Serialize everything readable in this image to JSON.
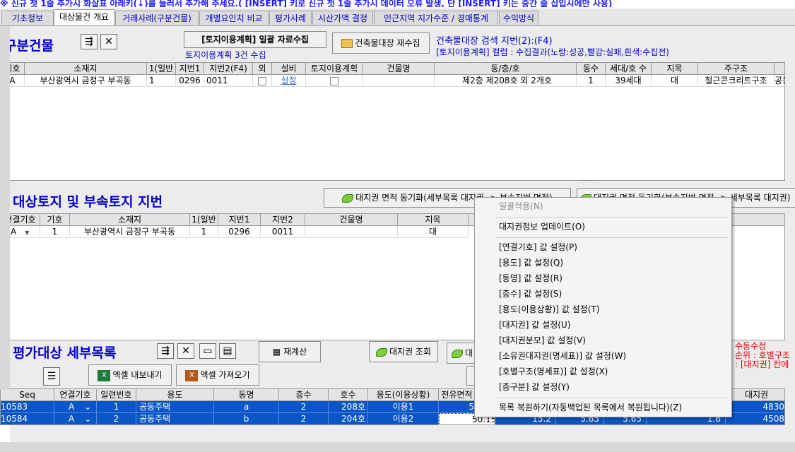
{
  "notice": "※ 신규 첫 1줄 추가시 화살표 아래키(↓)를 눌러서 추가해 주세요.( [INSERT] 키로 신규 첫 1줄 추가시 데이터 오류 발생, 단 [INSERT] 키는 중간 줄 삽입시에만 사용)",
  "tabs": [
    "기초정보",
    "대상물건 개요",
    "거래사례(구분건물)",
    "개별요인치 비교",
    "평가사례",
    "시산가액 결정",
    "인근지역 지가수준 / 경매통계",
    "수익방식"
  ],
  "section1": {
    "title": "구분건물",
    "bulk_button": "[토지이용계획] 일괄 자료수집",
    "recollect_button": "건축물대장 재수집",
    "search_info": "건축물대장 검색 지번(2):(F4)",
    "count_info": "토지이용계획 3건 수집",
    "legend_info": "[토지이용계획] 컬럼 : 수집결과(노랑:성공,빨강:실패,흰색:수집전)",
    "columns": [
      "기호",
      "소재지",
      "1(일반",
      "지번1",
      "지번2(F4)",
      "외",
      "설비",
      "토지이용계획",
      "건물명",
      "동/층/호",
      "동수",
      "세대/호 수",
      "지목",
      "주구조",
      ""
    ],
    "row": [
      "A",
      "부산광역시 금정구 부곡동",
      "1",
      "0296",
      "0011",
      "",
      "설정",
      "",
      "",
      "제2층 제208호 외 2개호",
      "1",
      "39세대",
      "대",
      "철근콘크리트구조",
      "공동주"
    ]
  },
  "section2": {
    "title": "대상토지 및 부속토지 지번",
    "sync_button_1": "대지권 면적 동기화(세부목록 대지권 -> 부속지번 면적)",
    "sync_button_2": "대지권 면적 동기화(부속지번 면적 -> 세부목록 대지권)",
    "columns": [
      "연결기호",
      "기호",
      "소재지",
      "1(일반",
      "지번1",
      "지번2",
      "건물명",
      "지목"
    ],
    "row": [
      "A",
      "1",
      "부산광역시 금정구 부곡동",
      "1",
      "0296",
      "0011",
      "",
      "대"
    ]
  },
  "section3": {
    "title": "평가대상 세부목록",
    "recalc_button": "재계산",
    "lookup_button": "대지권 조회",
    "lookup_button_2": "대",
    "export_button": "엑셀 내보내기",
    "import_button": "엑셀 가져오기",
    "red_notes": [
      "수동수정",
      "순위 : 호별구조",
      ": [대지권] 칸에"
    ],
    "columns": [
      "Seq",
      "연결기호",
      "일련번호",
      "용도",
      "동명",
      "층수",
      "호수",
      "용도(이용상황)",
      "전유면적",
      "",
      "",
      "",
      "",
      "대지권",
      ""
    ],
    "rows": [
      [
        "10583",
        "A",
        "1",
        "공동주택",
        "a",
        "2",
        "208호",
        "이용1",
        "5",
        "",
        "",
        "",
        "",
        "4830",
        ""
      ],
      [
        "10584",
        "A",
        "2",
        "공동주택",
        "b",
        "2",
        "204호",
        "이용2",
        "50.15",
        "15.2",
        "5.65",
        "5.65",
        "1.6",
        "4508",
        ""
      ]
    ]
  },
  "context_menu": {
    "items": [
      {
        "label": "일괄적용(N)",
        "disabled": true
      },
      {
        "label": "대지권정보 업데이트(O)"
      },
      {
        "label": "[연결기호] 값 설정(P)"
      },
      {
        "label": "[용도] 값 설정(Q)"
      },
      {
        "label": "[동명] 값 설정(R)"
      },
      {
        "label": "[층수] 값 설정(S)"
      },
      {
        "label": "[용도(이용상황)] 값 설정(T)"
      },
      {
        "label": "[대지권] 값 설정(U)"
      },
      {
        "label": "[대지권분모] 값 설정(V)"
      },
      {
        "label": "[소유권대지권(명세표)] 값 설정(W)"
      },
      {
        "label": "[호별구조(명세표)] 값 설정(X)"
      },
      {
        "label": "[층구분] 값 설정(Y)"
      },
      {
        "label": "목록 복원하기(자동백업된 목록에서 복원됩니다)(Z)"
      }
    ]
  },
  "colors": {
    "accent_blue": "#0000cc",
    "selected_row": "#0a56c8",
    "warning_red": "#e00000"
  }
}
